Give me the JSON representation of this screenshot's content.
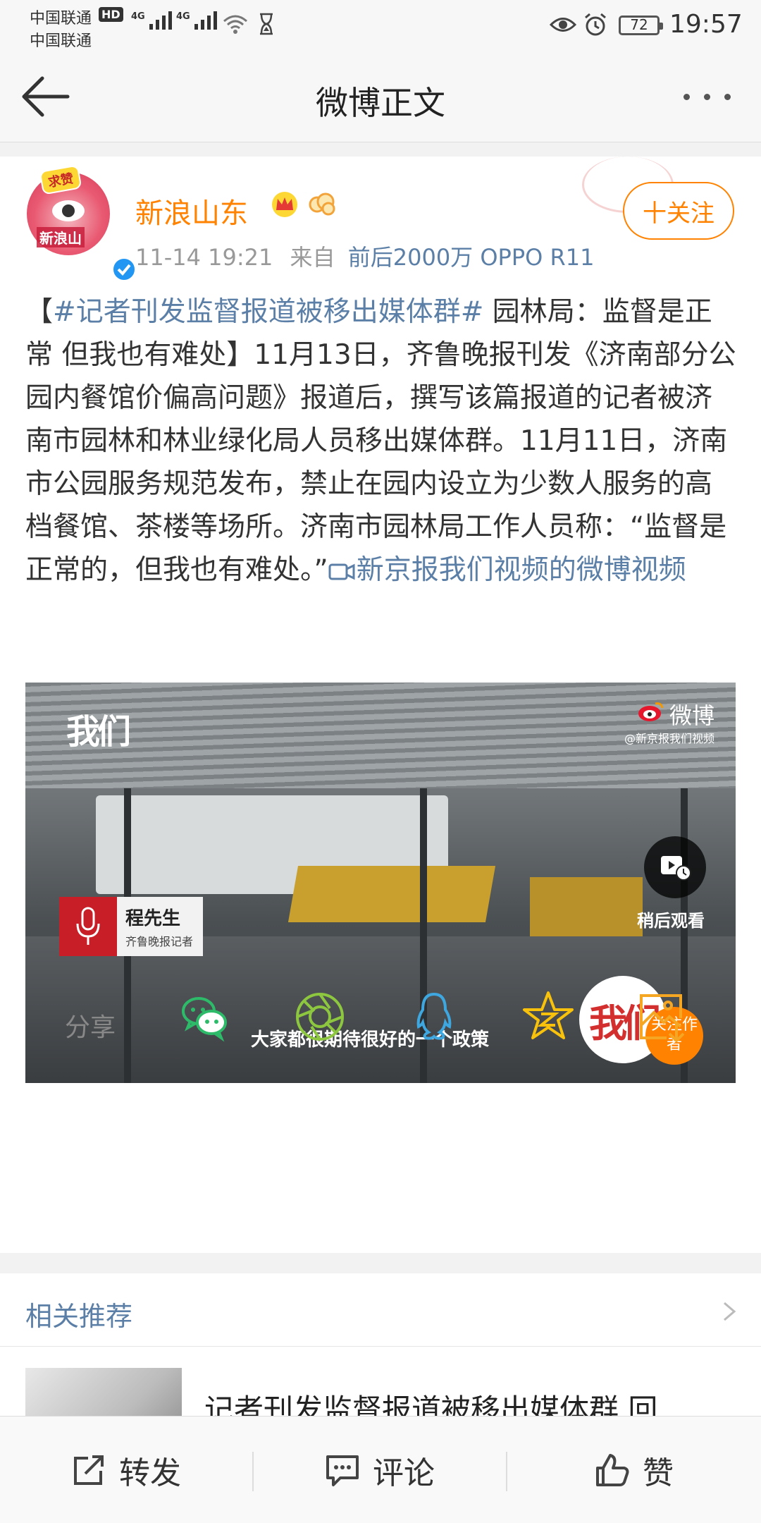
{
  "status_bar": {
    "carrier_1": "中国联通",
    "carrier_2": "中国联通",
    "hd": "HD",
    "network_1": "4G",
    "network_2": "4G",
    "battery": "72",
    "time": "19:57"
  },
  "nav": {
    "title": "微博正文"
  },
  "post": {
    "username": "新浪山东",
    "avatar_badge": "求赞",
    "avatar_label": "新浪山",
    "timestamp": "11-14 19:21",
    "from_label": "来自",
    "source": "前后2000万 OPPO R11",
    "follow_label": "十关注",
    "text": {
      "bracket_open": "【",
      "hashtag": "#记者刊发监督报道被移出媒体群#",
      "body": " 园林局：监督是正常 但我也有难处】11月13日，齐鲁晚报刊发《济南部分公园内餐馆价偏高问题》报道后，撰写该篇报道的记者被济南市园林和林业绿化局人员移出媒体群。11月11日，济南市公园服务规范发布，禁止在园内设立为少数人服务的高档餐馆、茶楼等场所。济南市园林局工作人员称：“监督是正常的，但我也有难处。”",
      "video_link": "新京报我们视频的微博视频"
    }
  },
  "video": {
    "channel_logo": "我们",
    "watermark": "微博",
    "watermark_sub": "@新京报我们视频",
    "speaker_name": "程先生",
    "speaker_role": "齐鲁晚报记者",
    "watch_later": "稍后观看",
    "subtitle": "大家都很期待很好的一个政策",
    "author_logo": "我们",
    "follow_author": "关注作者"
  },
  "share": {
    "label": "分享",
    "targets": [
      "wechat-icon",
      "moments-icon",
      "qq-icon",
      "qzone-icon",
      "save-image-icon"
    ],
    "colors": {
      "wechat": "#2dbb6a",
      "moments": "#8dc63f",
      "qq": "#3ea7e0",
      "qzone": "#f7c10c",
      "save": "#f5a623"
    }
  },
  "related": {
    "title": "相关推荐",
    "item_title": "记者刊发监督报道被移出媒体群 回"
  },
  "bottom_bar": {
    "repost": "转发",
    "comment": "评论",
    "like": "赞"
  },
  "colors": {
    "accent_orange": "#ff8200",
    "link_blue": "#5b7fa6"
  }
}
